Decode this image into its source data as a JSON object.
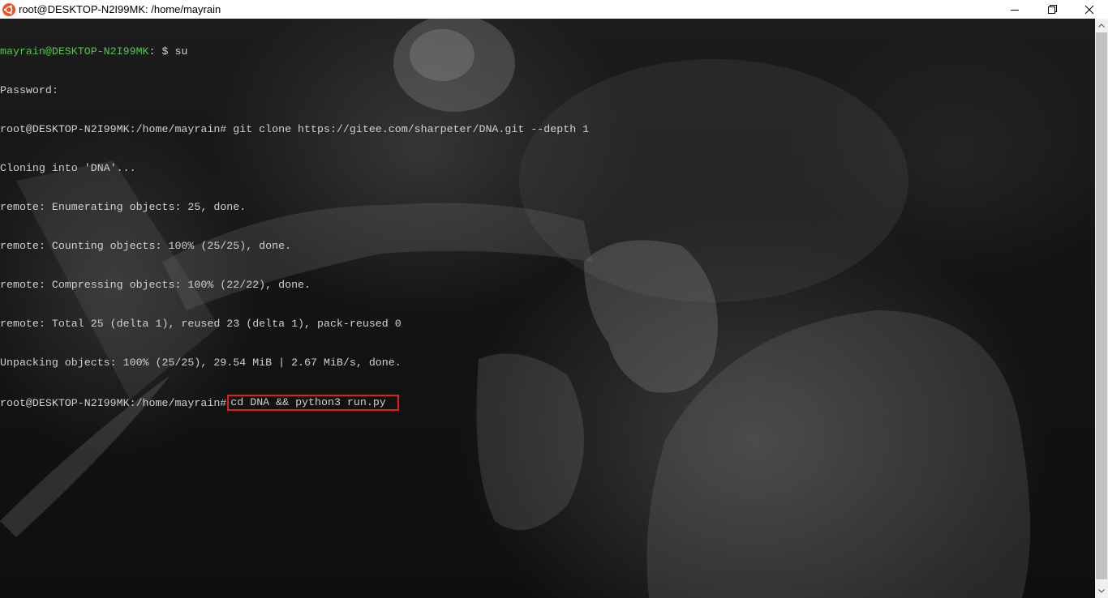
{
  "window": {
    "title": "root@DESKTOP-N2I99MK: /home/mayrain",
    "app_icon": "ubuntu-icon",
    "controls": [
      "minimize-icon",
      "maximize-icon",
      "close-icon"
    ]
  },
  "terminal": {
    "lines": [
      {
        "user": "mayrain@DESKTOP-N2I99MK",
        "rest": ": $ su"
      },
      {
        "text": "Password:"
      },
      {
        "text": "root@DESKTOP-N2I99MK:/home/mayrain# git clone https://gitee.com/sharpeter/DNA.git --depth 1"
      },
      {
        "text": "Cloning into 'DNA'..."
      },
      {
        "text": "remote: Enumerating objects: 25, done."
      },
      {
        "text": "remote: Counting objects: 100% (25/25), done."
      },
      {
        "text": "remote: Compressing objects: 100% (22/22), done."
      },
      {
        "text": "remote: Total 25 (delta 1), reused 23 (delta 1), pack-reused 0"
      },
      {
        "text": "Unpacking objects: 100% (25/25), 29.54 MiB | 2.67 MiB/s, done."
      },
      {
        "prompt": "root@DESKTOP-N2I99MK:/home/mayrain#",
        "command": "cd DNA && python3 run.py"
      }
    ],
    "colors": {
      "user_prompt": "#4ec94e",
      "text": "#d0d0d0",
      "highlight_border": "#e02020"
    }
  }
}
